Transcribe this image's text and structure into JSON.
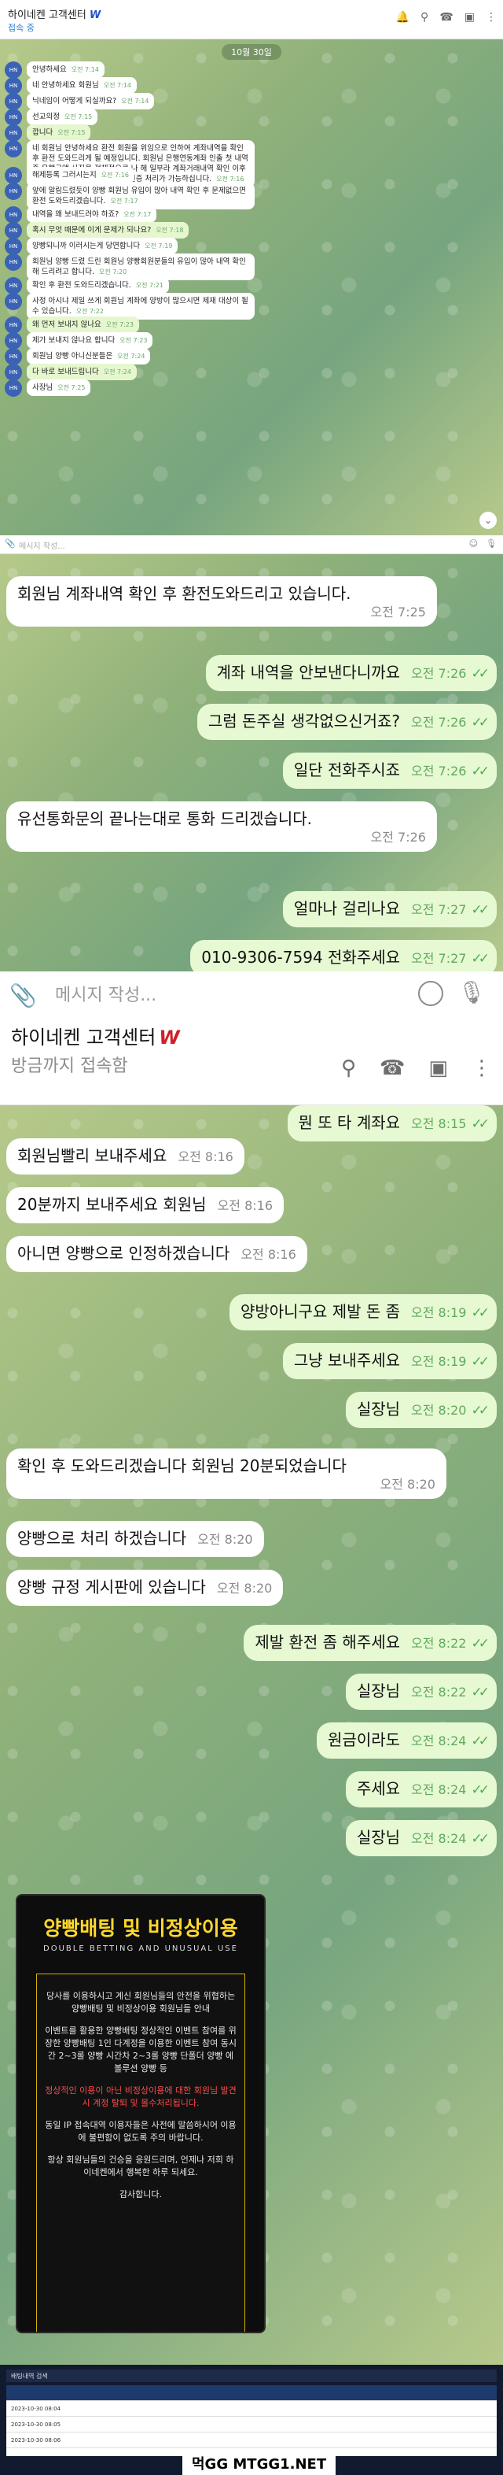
{
  "section1": {
    "title": "하이네켄 고객센터",
    "status": "접속 중",
    "date": "10월 30일",
    "messages": [
      {
        "text": "안녕하세요",
        "time": "오전 7:14",
        "me": false
      },
      {
        "text": "네 안녕하세요 회원님",
        "time": "오전 7:14",
        "me": false
      },
      {
        "text": "닉네임이 어떻게 되실까요?",
        "time": "오전 7:14",
        "me": false
      },
      {
        "text": "선교의정",
        "time": "오전 7:15",
        "me": false
      },
      {
        "text": "깝니다",
        "time": "오전 7:15",
        "me": true
      },
      {
        "text": "네 회원님 안녕하세요 환전 회원을 위임으로 인하여 계좌내역을 확인 후 환전 도와드리게 될 예정입니다. 회원님 은행연동계좌 인출 첫 내역 중 은행금액 사진을 전체적으로 나 해 일부라 계좌거래내역 확인 이후 유의사항 처리 완료 후 확인 후 인증 처리가 가능하십니다.",
        "time": "오전 7:16",
        "me": false
      },
      {
        "text": "해제등록 그러시는지",
        "time": "오전 7:16",
        "me": false
      },
      {
        "text": "앞에 알림드렸듯이 양빵 회원님 유입이 많아 내역 확인 후 문제없으면 환전 도와드리겠습니다.",
        "time": "오전 7:17",
        "me": false
      },
      {
        "text": "내역을 왜 보내드려야 하죠?",
        "time": "오전 7:17",
        "me": false
      },
      {
        "text": "혹시 무엇 때문에 이게 문제가 되나요?",
        "time": "오전 7:18",
        "me": true
      },
      {
        "text": "양빵되니까 이러시는게 당연합니다",
        "time": "오전 7:19",
        "me": false
      },
      {
        "text": "회원님 양빵 드렸 드린 회원님 양빵회원분들의 유입이 많아 내역 확인해 드리려고 합니다.",
        "time": "오전 7:20",
        "me": false
      },
      {
        "text": "확인 후 환전 도와드리겠습니다.",
        "time": "오전 7:21",
        "me": false
      },
      {
        "text": "사정 아시냐 제일 쓰게 회원님 계좌에 양방이 많으시면 제재 대상이 될 수 있습니다.",
        "time": "오전 7:22",
        "me": false
      },
      {
        "text": "왜 먼저 보내지 않나요",
        "time": "오전 7:23",
        "me": true
      },
      {
        "text": "제가 보내지 않나요 합니다",
        "time": "오전 7:23",
        "me": false
      },
      {
        "text": "회원님 양빵 아니신분들은",
        "time": "오전 7:24",
        "me": false
      },
      {
        "text": "다 바로 보내드립니다",
        "time": "오전 7:24",
        "me": true
      },
      {
        "text": "사장님",
        "time": "오전 7:25",
        "me": false
      }
    ],
    "input_placeholder": "메시지 작성..."
  },
  "section2": {
    "messages": [
      {
        "text": "회원님 계좌내역 확인 후 환전도와드리고 있습니다.",
        "time": "오전 7:25",
        "me": false
      },
      {
        "text": "계좌 내역을 안보낸다니까요",
        "time": "오전 7:26",
        "me": true
      },
      {
        "text": "그럼 돈주실 생각없으신거죠?",
        "time": "오전 7:26",
        "me": true
      },
      {
        "text": "일단 전화주시죠",
        "time": "오전 7:26",
        "me": true
      },
      {
        "text": "유선통화문의 끝나는대로 통화 드리겠습니다.",
        "time": "오전 7:26",
        "me": false
      },
      {
        "text": "얼마나 걸리나요",
        "time": "오전 7:27",
        "me": true
      },
      {
        "text": "010-9306-7594 전화주세요",
        "time": "오전 7:27",
        "me": true
      }
    ]
  },
  "input2": {
    "placeholder": "메시지 작성..."
  },
  "header3": {
    "title": "하이네켄 고객센터",
    "logo": "W",
    "status": "방금까지 접속함"
  },
  "section3": {
    "messages": [
      {
        "text": "뭔 또 타 계좌요",
        "time": "오전 8:15",
        "me": true
      },
      {
        "text": "회원님빨리 보내주세요",
        "time": "오전 8:16",
        "me": false
      },
      {
        "text": "20분까지 보내주세요 회원님",
        "time": "오전 8:16",
        "me": false
      },
      {
        "text": "아니면 양빵으로 인정하겠습니다",
        "time": "오전 8:16",
        "me": false
      },
      {
        "text": "양방아니구요 제발 돈 좀",
        "time": "오전 8:19",
        "me": true
      },
      {
        "text": "그냥 보내주세요",
        "time": "오전 8:19",
        "me": true
      },
      {
        "text": "실장님",
        "time": "오전 8:20",
        "me": true
      },
      {
        "text": "확인 후 도와드리겠습니다 회원님 20분되었습니다",
        "time": "오전 8:20",
        "me": false
      },
      {
        "text": "양빵으로 처리 하겠습니다",
        "time": "오전 8:20",
        "me": false
      },
      {
        "text": "양빵 규정 게시판에 있습니다",
        "time": "오전 8:20",
        "me": false
      },
      {
        "text": "제발 환전 좀 해주세요",
        "time": "오전 8:22",
        "me": true
      },
      {
        "text": "실장님",
        "time": "오전 8:22",
        "me": true
      },
      {
        "text": "원금이라도",
        "time": "오전 8:24",
        "me": true
      },
      {
        "text": "주세요",
        "time": "오전 8:24",
        "me": true
      },
      {
        "text": "실장님",
        "time": "오전 8:24",
        "me": true
      }
    ]
  },
  "poster": {
    "title": "양빵배팅 및 비정상이용",
    "subtitle": "DOUBLE BETTING AND UNUSUAL USE",
    "paragraphs": [
      "당사를 이용하시고 계신 회원님들의 안전을 위협하는 양빵배팅 및 비정상이용 회원님들 안내",
      "이벤트를 활용한 양빵배팅 정상적인 이벤트 참여를 위장한 양빵배팅 1인 다계정을 이용한 이벤트 참여 동시간 2~3롤 양빵 시간차 2~3롤 양빵 단폴더 양빵 에볼루션 양빵 등",
      "정상적인 이용이 아닌 비정상이용에 대한 회원님 발견시 계정 탈퇴 및 몰수처리됩니다.",
      "동일 IP 접속대역 이용자들은 사전에 말씀하시어 이용에 불편함이 없도록 주의 바랍니다.",
      "항상 회원님들의 건승을 응원드리며, 언제나 저희 하이네켄에서 행복한 하루 되세요.",
      "감사합니다."
    ]
  },
  "strip": {
    "bar_text": "배팅내역 검색",
    "rows": [
      "2023-10-30 08:04",
      "2023-10-30 08:05",
      "2023-10-30 08:06"
    ],
    "watermark": "먹GG MTGG1.NET"
  }
}
